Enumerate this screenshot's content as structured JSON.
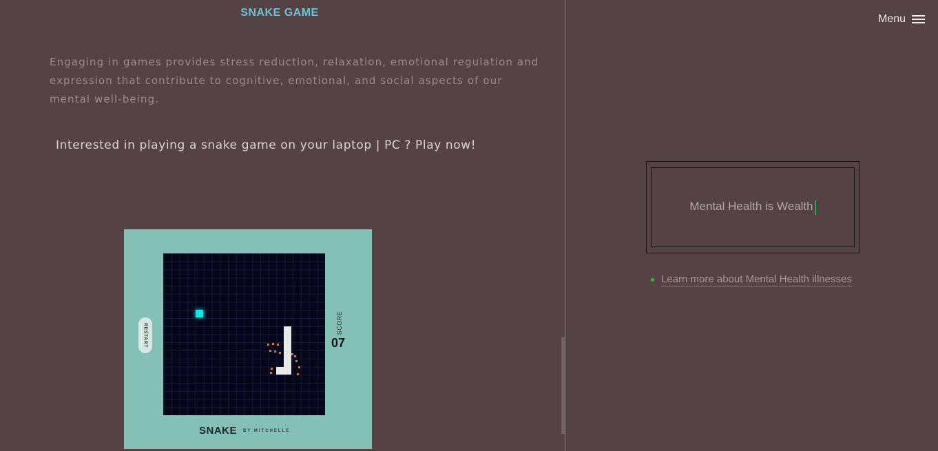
{
  "left": {
    "title": "SNAKE GAME",
    "intro": "Engaging in games provides stress reduction, relaxation, emotional regulation and expression that contribute to cognitive, emotional, and social aspects of our mental well-being.",
    "cta": "Interested in playing a snake game on your laptop | PC ? Play now!"
  },
  "game": {
    "restart_label": "RESTART",
    "score_label": "SCORE",
    "score_value": "07",
    "name": "SNAKE",
    "author": "BY MITCHELLE",
    "colors": {
      "card": "#84c0b6",
      "board": "#06061a",
      "food": "#19e3e3",
      "snake": "#e9e9e9"
    }
  },
  "nav": {
    "menu_label": "Menu",
    "menu_icon": "hamburger-icon"
  },
  "right": {
    "quote": "Mental Health is Wealth",
    "link": "Learn more about Mental Health illnesses"
  }
}
